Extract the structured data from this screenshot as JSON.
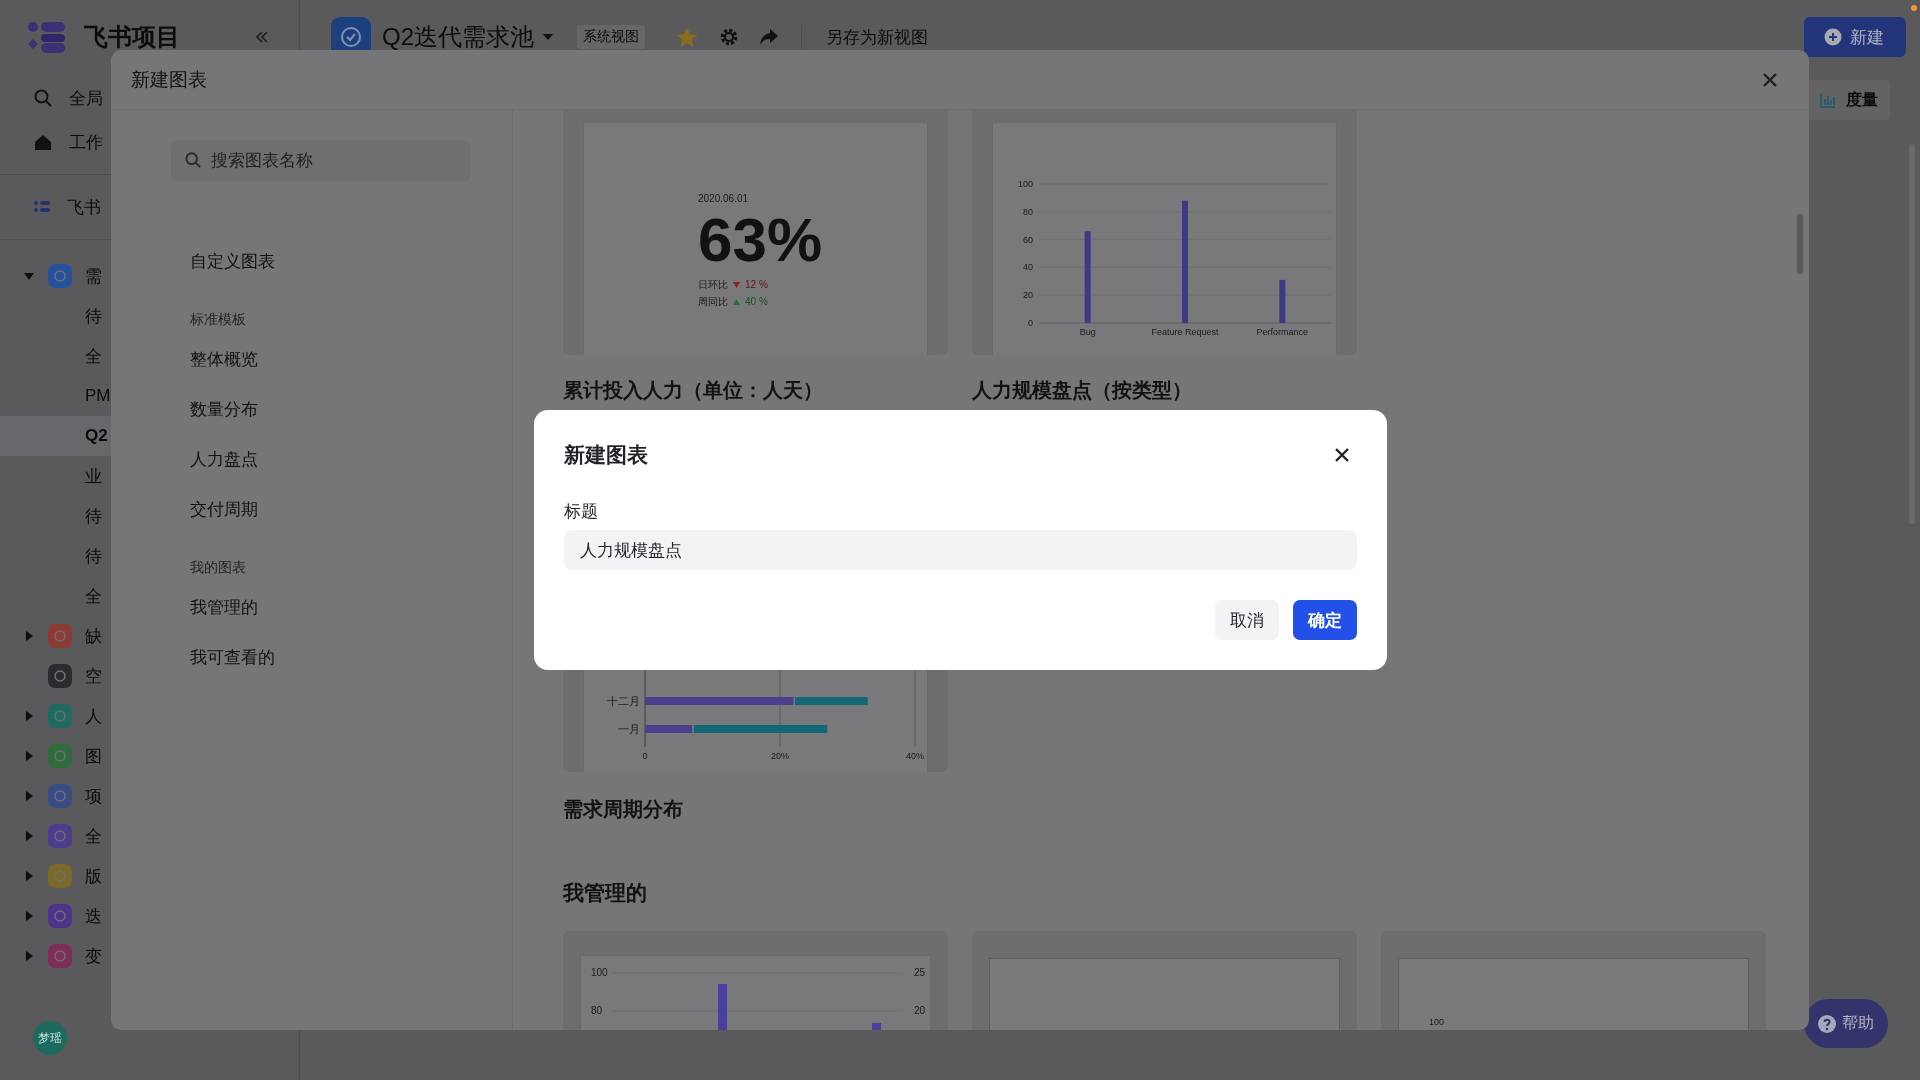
{
  "app": {
    "logo": "飞书项目",
    "project_title": "Q2迭代需求池",
    "view_tag": "系统视图",
    "starred": true,
    "save_view": "另存为新视图",
    "new_button": "新建",
    "metric_tab": "度量",
    "help_button": "帮助",
    "avatar": "梦瑶",
    "notification": true
  },
  "sidebar": {
    "search": "全局",
    "home": "工作",
    "space": "飞书",
    "tree": [
      {
        "label": "需",
        "color": "#24509c",
        "expanded": true,
        "selected": false,
        "children": [
          {
            "label": "待",
            "selected": false
          },
          {
            "label": "全",
            "selected": false
          },
          {
            "label": "PM",
            "selected": false
          },
          {
            "label": "Q2",
            "selected": true
          },
          {
            "label": "业",
            "selected": false
          },
          {
            "label": "待",
            "selected": false
          },
          {
            "label": "待",
            "selected": false
          },
          {
            "label": "全",
            "selected": false
          }
        ]
      },
      {
        "label": "缺",
        "color": "#8c3b35",
        "expanded": false,
        "selected": false
      },
      {
        "label": "空",
        "color": "#2b2b2f",
        "selected": false
      },
      {
        "label": "人",
        "color": "#1f6b60",
        "expanded": false,
        "selected": false
      },
      {
        "label": "图",
        "color": "#2f6b3d",
        "expanded": false,
        "selected": false
      },
      {
        "label": "项",
        "color": "#3a4c86",
        "expanded": false,
        "selected": false
      },
      {
        "label": "全",
        "color": "#4e3c8c",
        "expanded": false,
        "selected": false
      },
      {
        "label": "版",
        "color": "#7d6a2a",
        "expanded": false,
        "selected": false
      },
      {
        "label": "迭",
        "color": "#4a3388",
        "expanded": false,
        "selected": false
      },
      {
        "label": "变",
        "color": "#7d2f58",
        "expanded": false,
        "selected": false
      }
    ]
  },
  "modal": {
    "title": "新建图表",
    "search": {
      "placeholder": "搜索图表名称"
    },
    "nav": [
      {
        "kind": "item",
        "label": "自定义图表"
      },
      {
        "kind": "section",
        "label": "标准模板"
      },
      {
        "kind": "item",
        "label": "整体概览"
      },
      {
        "kind": "item",
        "label": "数量分布"
      },
      {
        "kind": "item",
        "label": "人力盘点"
      },
      {
        "kind": "item",
        "label": "交付周期"
      },
      {
        "kind": "section",
        "label": "我的图表"
      },
      {
        "kind": "item",
        "label": "我管理的"
      },
      {
        "kind": "item",
        "label": "我可查看的"
      }
    ],
    "cards": [
      {
        "kind": "kpi",
        "title": "累计投入人力（单位：人天）",
        "date": "2020.06.01",
        "value": "63%",
        "rows": [
          {
            "label": "日环比",
            "rising": false,
            "value": "12 %"
          },
          {
            "label": "周同比",
            "rising": true,
            "value": "40 %"
          }
        ]
      },
      {
        "kind": "chart",
        "title": "人力规模盘点（按类型）",
        "chart_data": {
          "type": "bar",
          "categories": [
            "Bug",
            "Feature Request",
            "Performance"
          ],
          "values": [
            66,
            88,
            31
          ],
          "ylim": [
            0,
            100
          ],
          "yticks": [
            0,
            20,
            40,
            60,
            80,
            100
          ],
          "grid": true
        }
      },
      {
        "kind": "chart",
        "title": "需求周期分布",
        "chart_data": {
          "type": "bar",
          "orientation": "horizontal",
          "stacked": true,
          "categories": [
            "十二月",
            "一月"
          ],
          "series": [
            {
              "color": "#4b3f8e",
              "values": [
                22,
                7
              ]
            },
            {
              "color": "#136878",
              "values": [
                11,
                20
              ]
            }
          ],
          "xlim": [
            0,
            40
          ],
          "xticks": [
            {
              "value": 0,
              "label": "0"
            },
            {
              "value": 20,
              "label": "20%"
            },
            {
              "value": 40,
              "label": "40%"
            }
          ],
          "grid": true
        }
      }
    ],
    "managed_title": "我管理的",
    "managed_cards": [
      {
        "kind": "combo",
        "left_ticks": [
          "100",
          "80"
        ],
        "right_ticks": [
          "25",
          "20"
        ]
      },
      {
        "kind": "empty"
      },
      {
        "kind": "axis",
        "ticks": [
          "100"
        ]
      }
    ]
  },
  "dialog": {
    "title": "新建图表",
    "field_label": "标题",
    "field_value": "人力规模盘点",
    "cancel": "取消",
    "confirm": "确定"
  }
}
